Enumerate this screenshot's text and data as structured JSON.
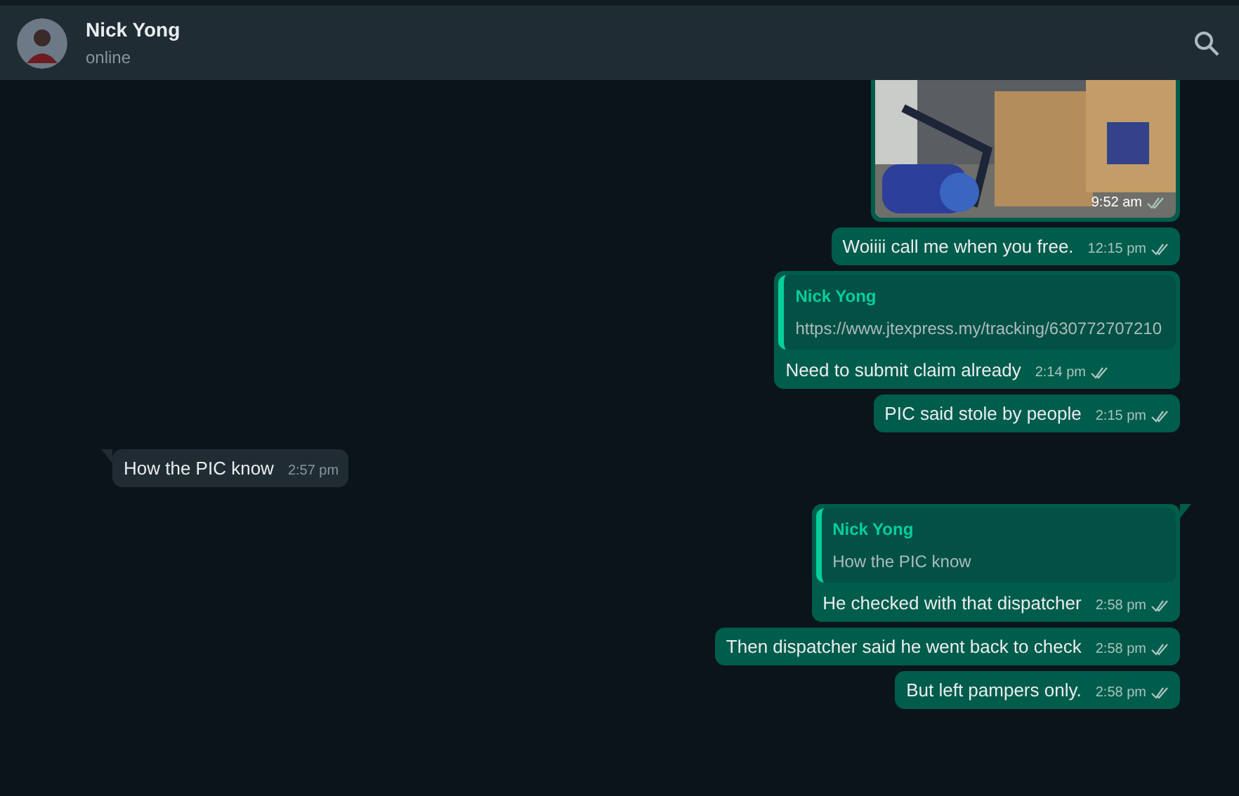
{
  "header": {
    "name": "Nick Yong",
    "status": "online"
  },
  "messages": [
    {
      "outgoing": true,
      "time": "9:52 am"
    },
    {
      "kind": "text",
      "outgoing": true,
      "text": "Woiiii call me when you free.",
      "time": "12:15 pm"
    },
    {
      "kind": "reply",
      "outgoing": true,
      "quote_name": "Nick Yong",
      "quote_text": "https://www.jtexpress.my/tracking/630772707210",
      "text": "Need to submit claim already",
      "time": "2:14 pm"
    },
    {
      "kind": "text",
      "outgoing": true,
      "text": "PIC said stole by people",
      "time": "2:15 pm"
    },
    {
      "kind": "text",
      "outgoing": false,
      "tail": true,
      "text": "How the PIC know",
      "time": "2:57 pm"
    },
    {
      "kind": "reply",
      "outgoing": true,
      "tail": true,
      "quote_name": "Nick Yong",
      "quote_text": "How the PIC know",
      "text": "He checked with that dispatcher",
      "time": "2:58 pm"
    },
    {
      "kind": "text",
      "outgoing": true,
      "text": "Then dispatcher said he went back to check",
      "time": "2:58 pm"
    },
    {
      "kind": "text",
      "outgoing": true,
      "text": "But left pampers only.",
      "time": "2:58 pm"
    }
  ]
}
